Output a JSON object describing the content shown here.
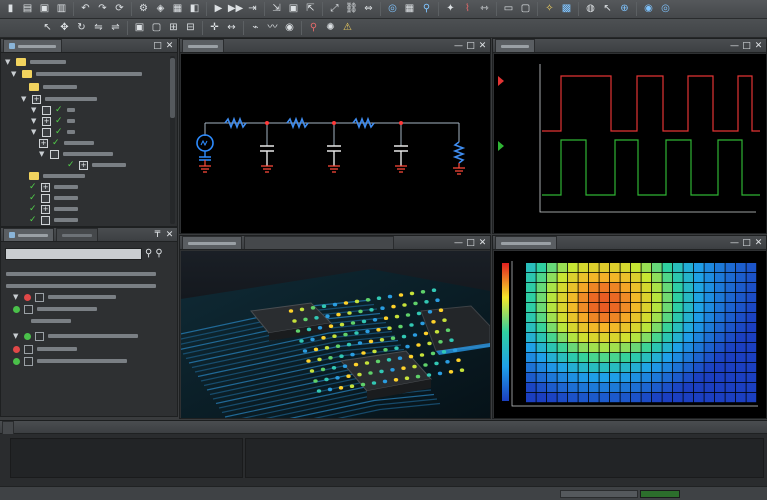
{
  "toolbar_primary": {
    "icons": [
      "new-folder-icon",
      "open-folder-icon",
      "save-icon",
      "print-icon",
      "undo-icon",
      "redo-icon",
      "refresh-icon",
      "settings-icon",
      "component-icon",
      "chip-icon",
      "layer-icon",
      "forward-icon",
      "fast-forward-icon",
      "step-icon",
      "align-icon",
      "board-icon",
      "export-icon",
      "expand-icon",
      "link-icon",
      "arrows-icon",
      "probe-icon",
      "grid-icon",
      "zoom-icon",
      "pin-icon",
      "route-icon",
      "measure-icon",
      "window-icon",
      "monitor-icon",
      "wand-icon",
      "picture-icon",
      "globe-icon",
      "cursor-icon",
      "target-icon",
      "camera-icon",
      "eye-icon"
    ],
    "glyphs": [
      "▮",
      "▤",
      "▣",
      "▥",
      "↶",
      "↷",
      "⟳",
      "⚙",
      "◈",
      "▦",
      "◧",
      "▶",
      "▶▶",
      "⇥",
      "⇲",
      "▣",
      "⇱",
      "⤢",
      "⛓",
      "⇔",
      "◎",
      "▦",
      "⚲",
      "✦",
      "⌇",
      "⇿",
      "▭",
      "▢",
      "✧",
      "▩",
      "◍",
      "↖",
      "⊕",
      "◉",
      "◎"
    ]
  },
  "toolbar_secondary": {
    "icons": [
      "select-icon",
      "move-icon",
      "rotate-icon",
      "flip-icon",
      "mirror-icon",
      "group-icon",
      "ungroup-icon",
      "snap-icon",
      "grid-snap-icon",
      "cross-icon",
      "dimension-icon",
      "net-icon",
      "trace-icon",
      "via-icon",
      "search-icon",
      "highlight-icon",
      "warning-icon"
    ],
    "glyphs": [
      "↖",
      "✥",
      "↻",
      "⇋",
      "⇌",
      "▣",
      "▢",
      "⊞",
      "⊟",
      "✛",
      "↔",
      "⌁",
      "〰",
      "◉",
      "⚲",
      "✺",
      "⚠"
    ]
  },
  "panels": {
    "project_tree": {
      "tab": "",
      "buttons": [
        "□",
        "✕"
      ]
    },
    "schematic": {
      "tab": "",
      "buttons": [
        "—",
        "□",
        "✕"
      ]
    },
    "waveform": {
      "tab": "",
      "buttons": [
        "—",
        "□",
        "✕"
      ]
    },
    "properties": {
      "tab": "",
      "buttons": [
        "₸",
        "✕"
      ],
      "search_placeholder": ""
    },
    "board_3d": {
      "tab": "",
      "buttons": [
        "—",
        "□",
        "✕"
      ]
    },
    "thermal_map": {
      "tab": "",
      "buttons": [
        "—",
        "□",
        "✕"
      ]
    },
    "console": {
      "tab": ""
    }
  },
  "tree_glyphs": {
    "expand": "▼",
    "collapse": "▶",
    "check": "✓",
    "plus": "+",
    "minus": "−"
  },
  "colors": {
    "schematic_wire": "#a4b3c2",
    "resistor": "#3f8df0",
    "capacitor": "#e8e8e8",
    "node": "#ff3a3a",
    "ground": "#ff4a3a",
    "source": "#2d8cff",
    "wave_top": "#e23434",
    "wave_bottom": "#2fb434",
    "thermal_hot": "#e02020",
    "thermal_cold": "#1b5fd0",
    "accent_green": "#52d14a"
  }
}
